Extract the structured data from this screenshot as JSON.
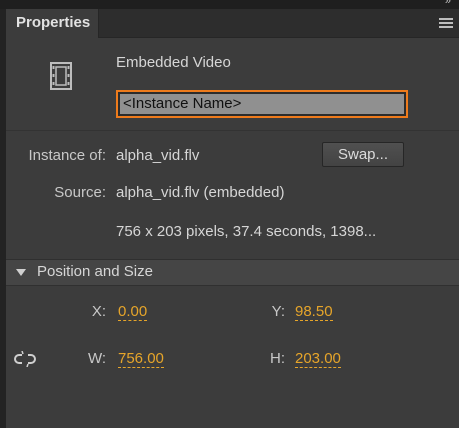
{
  "panel": {
    "tab_label": "Properties"
  },
  "symbol": {
    "type_label": "Embedded Video",
    "instance_name_placeholder": "<Instance Name>"
  },
  "info": {
    "instance_of_label": "Instance of:",
    "instance_of_value": "alpha_vid.flv",
    "swap_label": "Swap...",
    "source_label": "Source:",
    "source_value": "alpha_vid.flv (embedded)",
    "details_value": "756 x 203 pixels, 37.4 seconds, 1398..."
  },
  "position_size": {
    "title": "Position and Size",
    "x_label": "X:",
    "x_value": "0.00",
    "y_label": "Y:",
    "y_value": "98.50",
    "w_label": "W:",
    "w_value": "756.00",
    "h_label": "H:",
    "h_value": "203.00"
  },
  "colors": {
    "panel_bg": "#3c3c3c",
    "focus_border": "#ee7b1c",
    "numeric_value": "#e6a52a"
  },
  "icons": [
    "collapse-panel-icon",
    "panel-menu-icon",
    "video-film-icon",
    "section-collapse-triangle-icon",
    "constrain-proportions-link-icon"
  ]
}
